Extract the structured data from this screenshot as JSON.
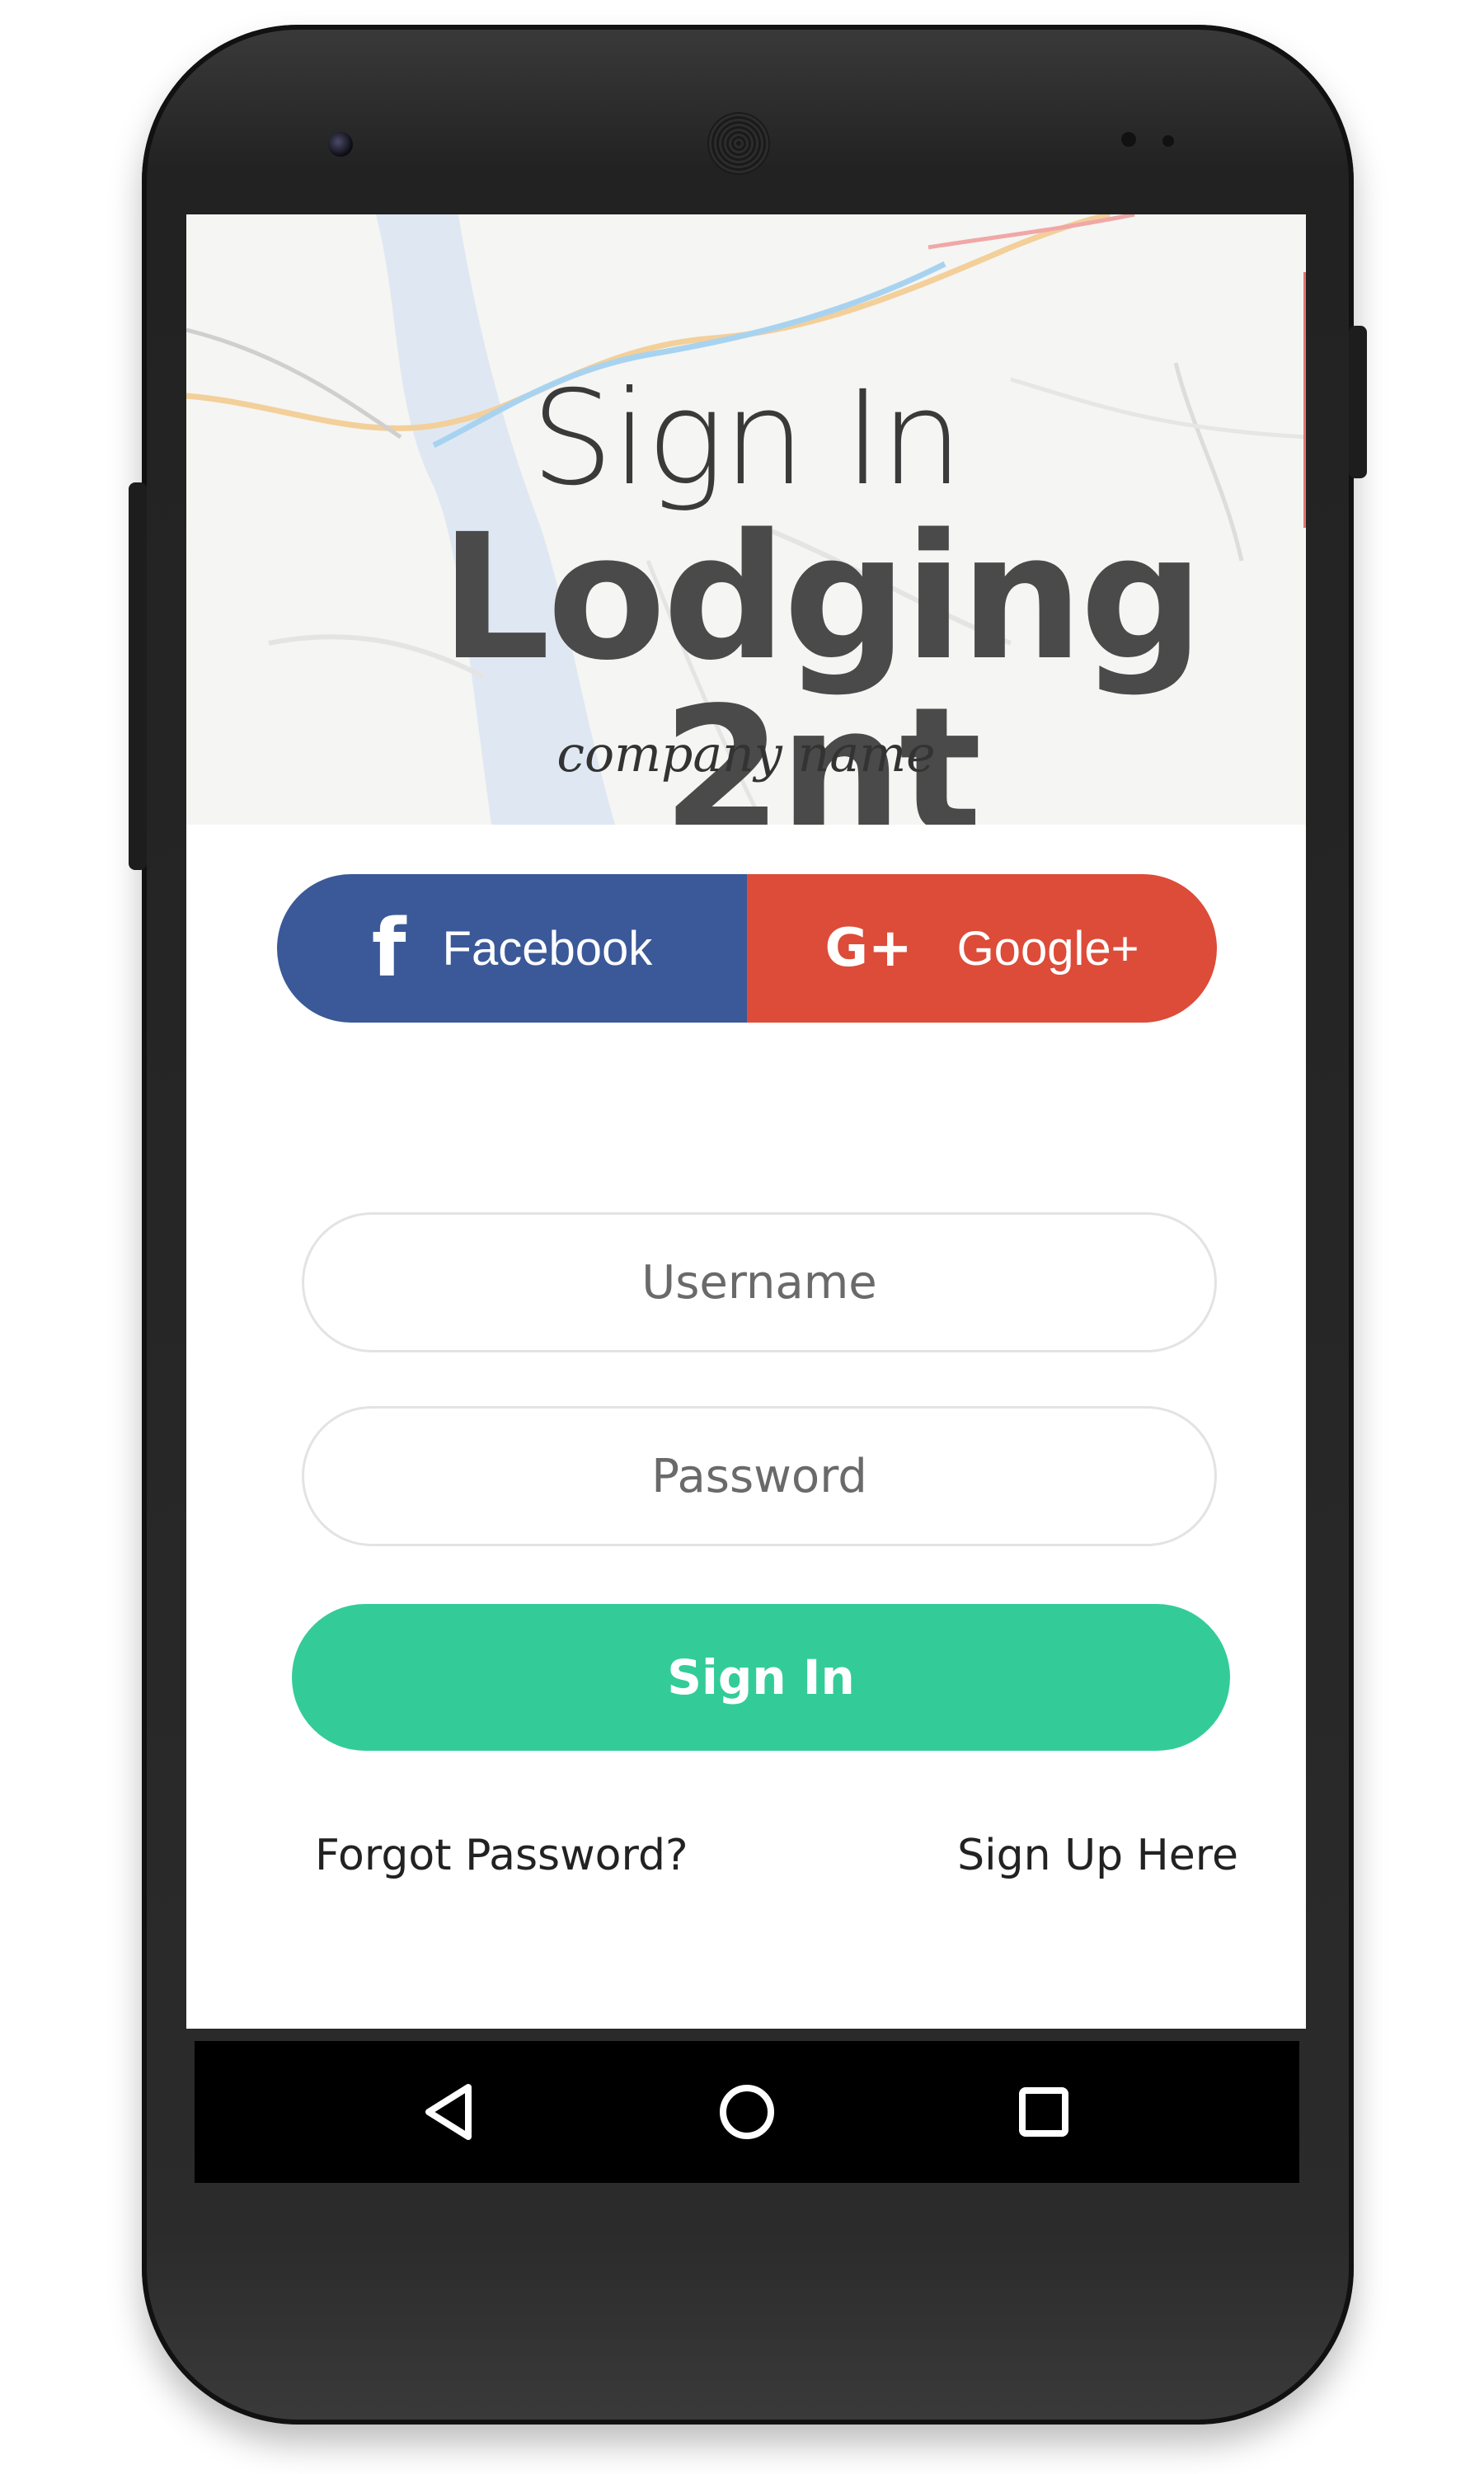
{
  "hero": {
    "title": "Sign In",
    "brand": "Lodging 2nt",
    "tagline": "company name"
  },
  "social": {
    "facebook_label": "Facebook",
    "google_label": "Google+",
    "facebook_color": "#3b5998",
    "google_color": "#dd4b39"
  },
  "form": {
    "username_placeholder": "Username",
    "password_placeholder": "Password",
    "signin_label": "Sign In",
    "signin_color": "#33cc99"
  },
  "links": {
    "forgot": "Forgot Password?",
    "signup": "Sign Up Here"
  },
  "navbar": {
    "icons": [
      "back-icon",
      "home-icon",
      "recent-apps-icon"
    ]
  }
}
